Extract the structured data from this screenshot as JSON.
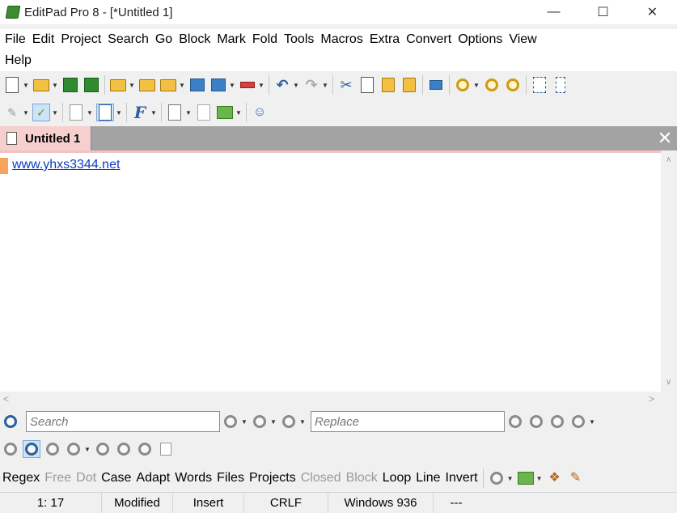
{
  "window": {
    "title": "EditPad Pro 8 - [*Untitled 1]",
    "controls": {
      "minimize": "—",
      "maximize": "☐",
      "close": "✕"
    }
  },
  "menu": {
    "row1": [
      "File",
      "Edit",
      "Project",
      "Search",
      "Go",
      "Block",
      "Mark",
      "Fold",
      "Tools",
      "Macros",
      "Extra",
      "Convert",
      "Options",
      "View"
    ],
    "row2": [
      "Help"
    ]
  },
  "tabs": [
    {
      "label": "Untitled 1",
      "close": "✕"
    }
  ],
  "editor": {
    "text": "www.yhxs3344.net"
  },
  "scroll": {
    "up": "∧",
    "down": "∨",
    "left": "<",
    "right": ">"
  },
  "search": {
    "search_placeholder": "Search",
    "replace_placeholder": "Replace"
  },
  "options": [
    {
      "label": "Regex",
      "enabled": true
    },
    {
      "label": "Free",
      "enabled": false
    },
    {
      "label": "Dot",
      "enabled": false
    },
    {
      "label": "Case",
      "enabled": true
    },
    {
      "label": "Adapt",
      "enabled": true
    },
    {
      "label": "Words",
      "enabled": true
    },
    {
      "label": "Files",
      "enabled": true
    },
    {
      "label": "Projects",
      "enabled": true
    },
    {
      "label": "Closed",
      "enabled": false
    },
    {
      "label": "Block",
      "enabled": false
    },
    {
      "label": "Loop",
      "enabled": true
    },
    {
      "label": "Line",
      "enabled": true
    },
    {
      "label": "Invert",
      "enabled": true
    }
  ],
  "status": {
    "position": "1: 17",
    "modified": "Modified",
    "mode": "Insert",
    "line_break": "CRLF",
    "encoding": "Windows 936",
    "extra": "---"
  },
  "icons": {
    "toolbar1": [
      "new-file-icon",
      "open-file-icon",
      "save-icon",
      "save-all-icon",
      "open-project-icon",
      "copy-folder-icon",
      "project-folder-icon",
      "save-project-icon",
      "add-project-icon",
      "remove-project-icon",
      "undo-icon",
      "redo-icon",
      "cut-icon",
      "copy-icon",
      "paste-icon",
      "paste-special-icon",
      "paste-block-icon",
      "zoom-search-icon",
      "search-down-icon",
      "search-up-icon",
      "select-block-icon",
      "column-select-icon"
    ],
    "toolbar2": [
      "syntax-highlight-icon",
      "spellcheck-icon",
      "page-format-icon",
      "text-layout-icon",
      "font-icon",
      "edit-file-icon",
      "edit-template-icon",
      "clip-collection-icon",
      "user-tools-icon"
    ]
  },
  "colors": {
    "tab_active": "#f6cfcf",
    "tab_bar": "#a3a3a3",
    "link_text": "#0b3dbf",
    "gutter_marker": "#f8a35a"
  }
}
